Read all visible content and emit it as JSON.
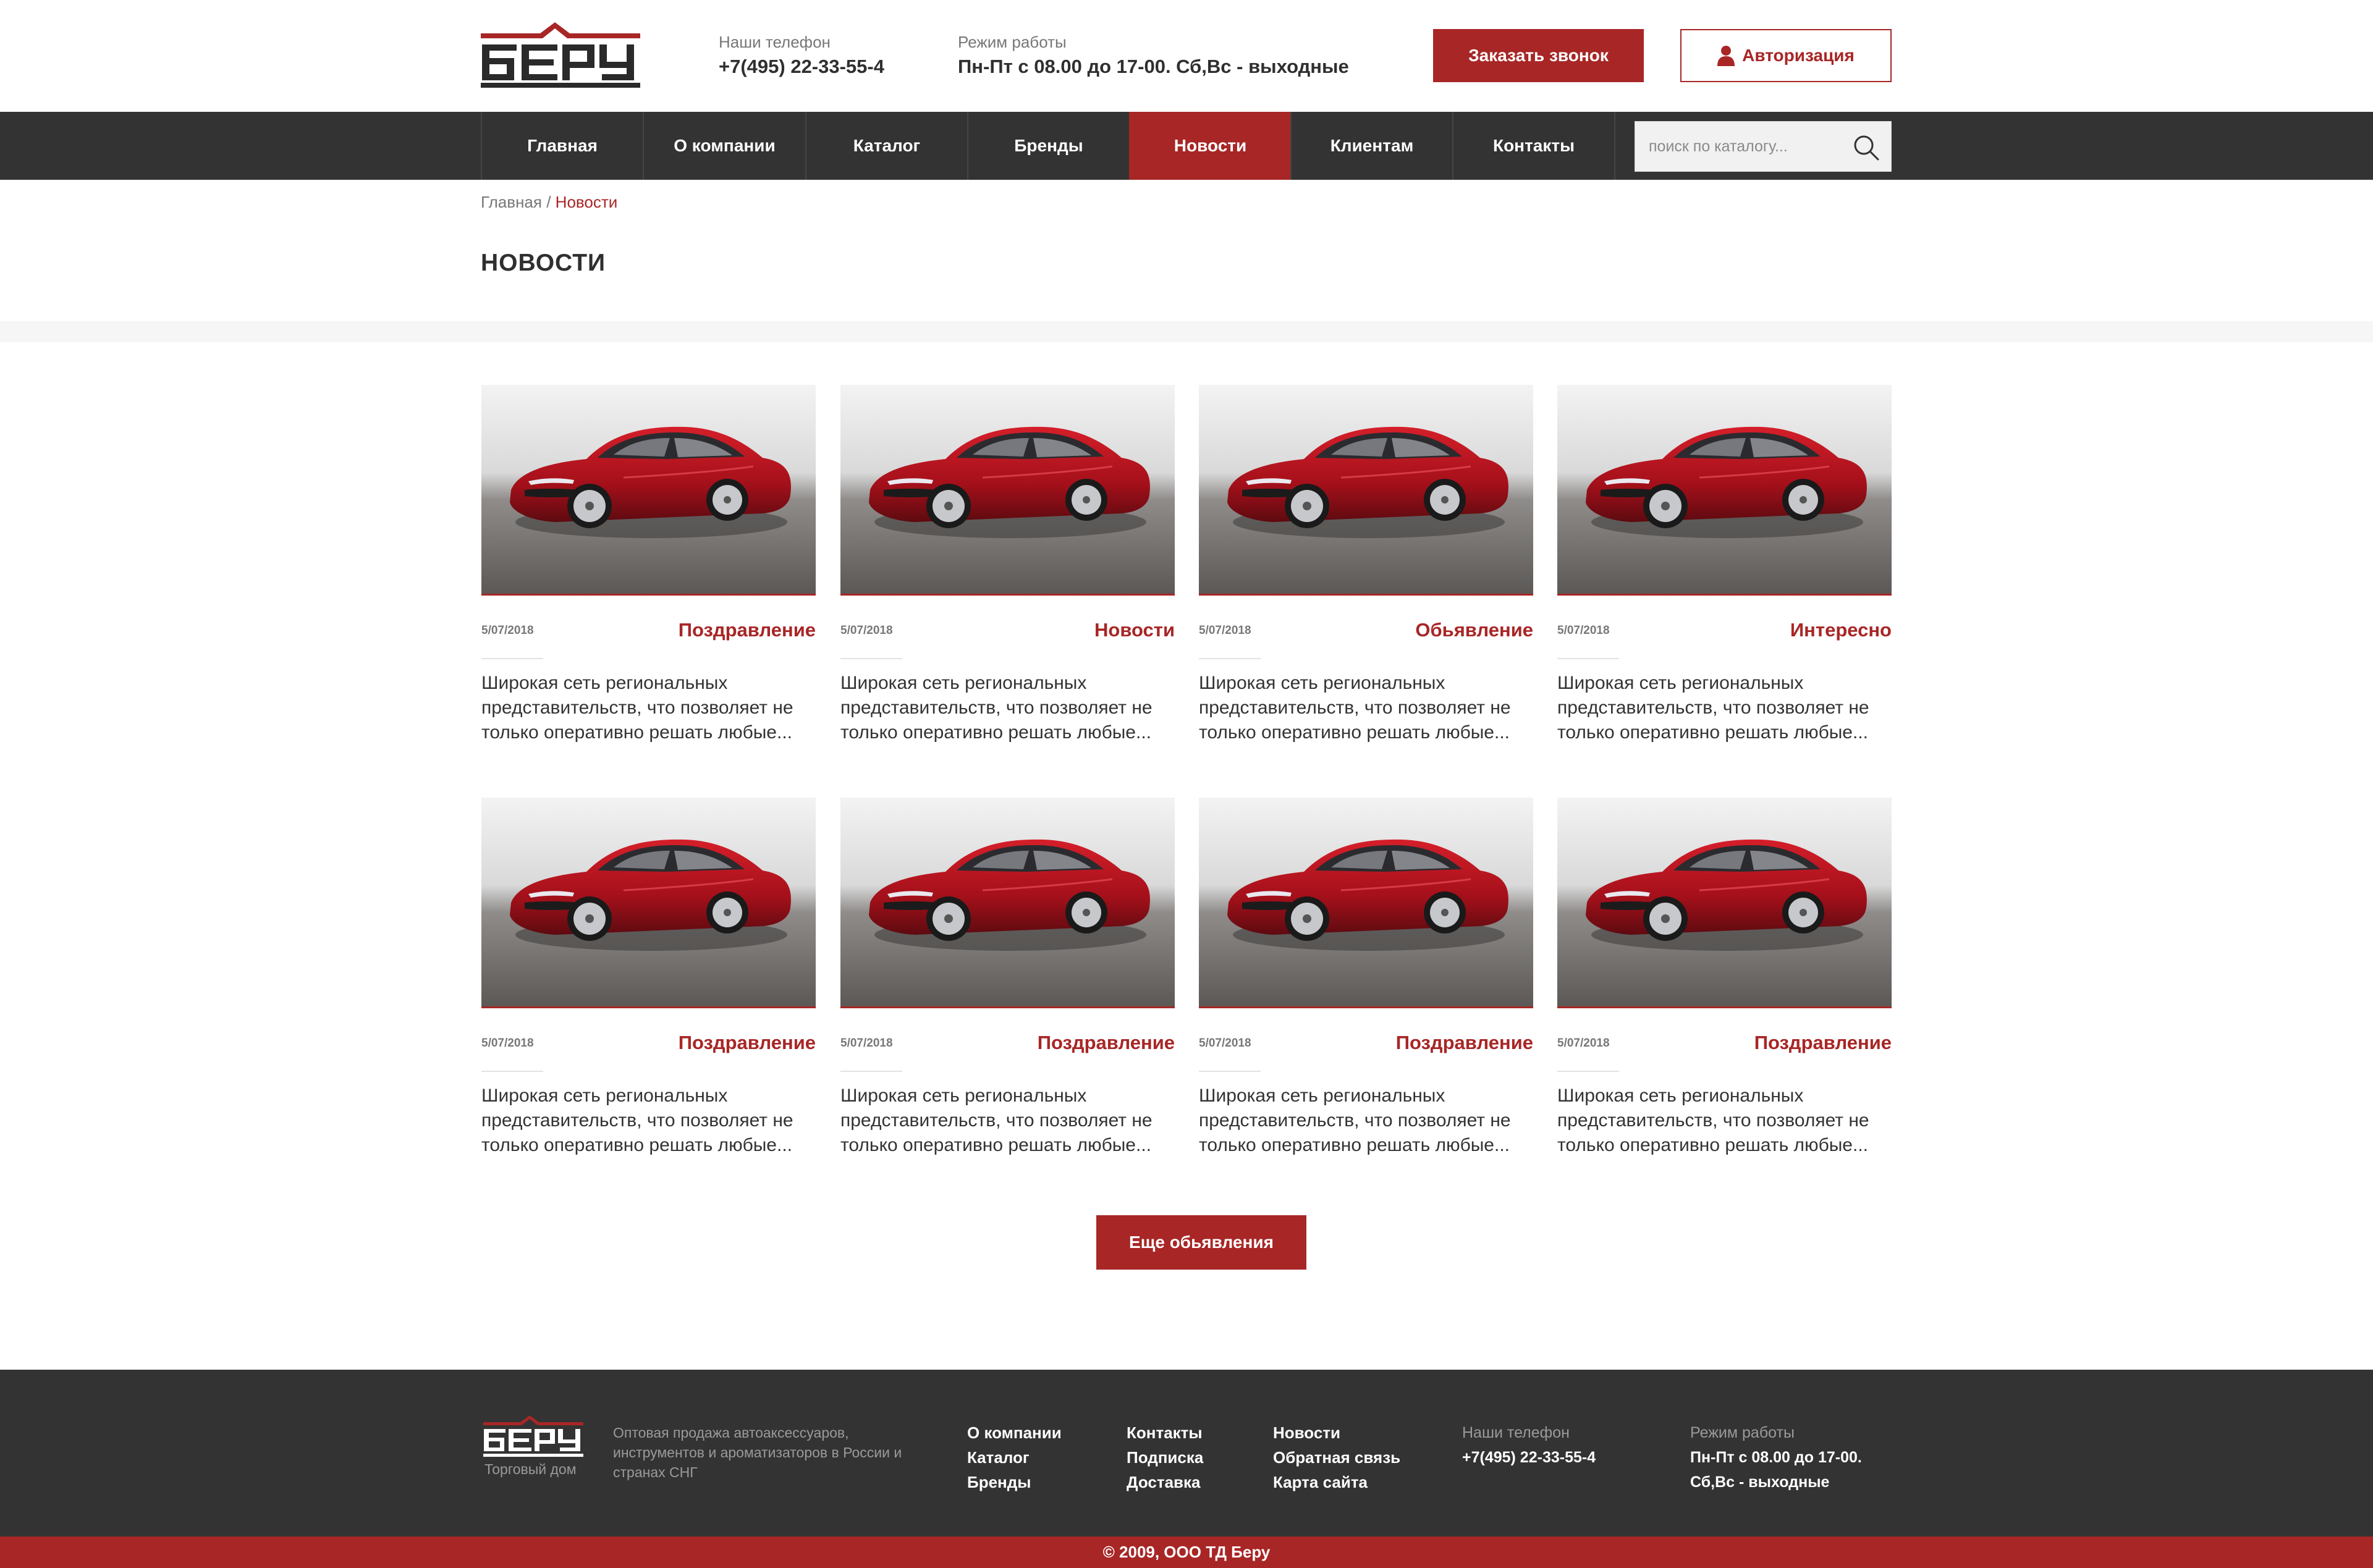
{
  "brand": {
    "logo_text": "БЕРУ",
    "accent_color": "#a82626",
    "dark_color": "#333333"
  },
  "header": {
    "phone_label": "Наши телефон",
    "phone_value": "+7(495) 22-33-55-4",
    "hours_label": "Режим работы",
    "hours_value": "Пн-Пт с 08.00 до 17-00. Сб,Вс - выходные",
    "callback_label": "Заказать звонок",
    "auth_label": "Авторизация",
    "auth_icon": "user-icon"
  },
  "nav": {
    "items": [
      {
        "label": "Главная",
        "active": false
      },
      {
        "label": "О компании",
        "active": false
      },
      {
        "label": "Каталог",
        "active": false
      },
      {
        "label": "Бренды",
        "active": false
      },
      {
        "label": "Новости",
        "active": true
      },
      {
        "label": "Клиентам",
        "active": false
      },
      {
        "label": "Контакты",
        "active": false
      }
    ],
    "search_placeholder": "поиск по каталогу...",
    "search_icon": "search-icon"
  },
  "breadcrumb": {
    "home": "Главная",
    "separator": "/",
    "current": "Новости"
  },
  "page_title": "НОВОСТИ",
  "news": [
    {
      "date": "5/07/2018",
      "category": "Поздравление",
      "text": "Широкая сеть региональных представительств, что позволяет не только оперативно решать любые..."
    },
    {
      "date": "5/07/2018",
      "category": "Новости",
      "text": "Широкая сеть региональных представительств, что позволяет не только оперативно решать любые..."
    },
    {
      "date": "5/07/2018",
      "category": "Обьявление",
      "text": "Широкая сеть региональных представительств, что позволяет не только оперативно решать любые..."
    },
    {
      "date": "5/07/2018",
      "category": "Интересно",
      "text": "Широкая сеть региональных представительств, что позволяет не только оперативно решать любые..."
    },
    {
      "date": "5/07/2018",
      "category": "Поздравление",
      "text": "Широкая сеть региональных представительств, что позволяет не только оперативно решать любые..."
    },
    {
      "date": "5/07/2018",
      "category": "Поздравление",
      "text": "Широкая сеть региональных представительств, что позволяет не только оперативно решать любые..."
    },
    {
      "date": "5/07/2018",
      "category": "Поздравление",
      "text": "Широкая сеть региональных представительств, что позволяет не только оперативно решать любые..."
    },
    {
      "date": "5/07/2018",
      "category": "Поздравление",
      "text": "Широкая сеть региональных представительств, что позволяет не только оперативно решать любые..."
    }
  ],
  "more_button_label": "Еще обьявления",
  "footer": {
    "logo_caption": "Торговый дом",
    "description": "Оптовая продажа автоаксессуаров, инструментов и ароматизаторов в России и странах СНГ",
    "col1": [
      "О компании",
      "Каталог",
      "Бренды"
    ],
    "col2": [
      "Контакты",
      "Подписка",
      "Доставка"
    ],
    "col3": [
      "Новости",
      "Обратная связь",
      "Карта сайта"
    ],
    "phone_label": "Наши телефон",
    "phone_value": "+7(495) 22-33-55-4",
    "hours_label": "Режим работы",
    "hours_value": "Пн-Пт с 08.00 до 17-00. Сб,Вс - выходные",
    "copyright": "© 2009, ООО ТД Беру"
  }
}
